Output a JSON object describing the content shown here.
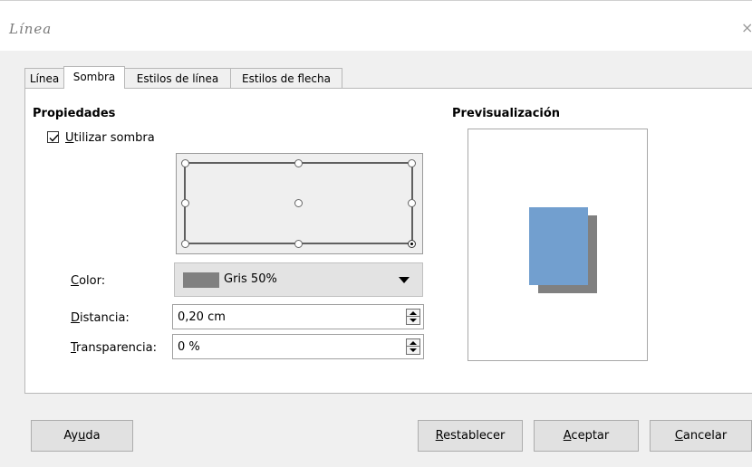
{
  "window": {
    "title": "Línea",
    "close_glyph": "×"
  },
  "tabs": [
    {
      "label": "Línea",
      "active": false
    },
    {
      "label": "Sombra",
      "active": true
    },
    {
      "label": "Estilos de línea",
      "active": false
    },
    {
      "label": "Estilos de flecha",
      "active": false
    }
  ],
  "properties": {
    "heading": "Propiedades",
    "use_shadow": {
      "label_first": "U",
      "label_rest": "tilizar sombra",
      "checked": true
    },
    "position_grid": {
      "selected": "bottom-right"
    },
    "color": {
      "label_first": "C",
      "label_rest": "olor:",
      "value": "Gris 50%",
      "swatch": "#808080"
    },
    "distance": {
      "label_first": "D",
      "label_rest": "istancia:",
      "value": "0,20 cm"
    },
    "transparency": {
      "label_first": "T",
      "label_rest": "ransparencia:",
      "value": "0 %"
    }
  },
  "preview": {
    "heading": "Previsualización",
    "object_color": "#729fcf",
    "shadow_color": "#808080"
  },
  "buttons": {
    "help": {
      "pre": "Ay",
      "acc": "u",
      "post": "da"
    },
    "reset": {
      "pre": "",
      "acc": "R",
      "post": "establecer"
    },
    "ok": {
      "pre": "",
      "acc": "A",
      "post": "ceptar"
    },
    "cancel": {
      "pre": "",
      "acc": "C",
      "post": "ancelar"
    }
  }
}
